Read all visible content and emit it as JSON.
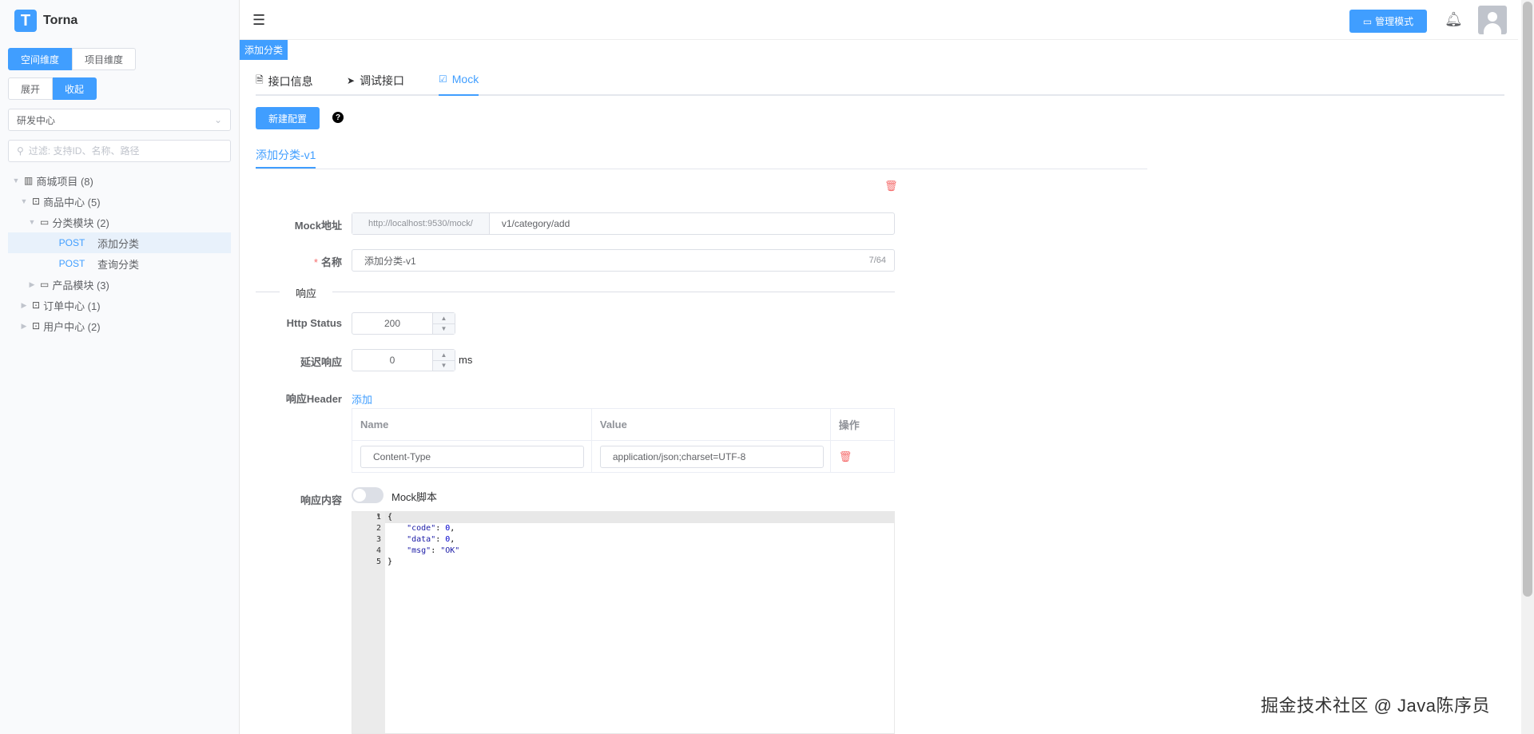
{
  "app": {
    "title": "Torna",
    "logo_letter": "T"
  },
  "sidebar": {
    "dimension_tabs": [
      {
        "label": "空间维度",
        "active": true
      },
      {
        "label": "项目维度",
        "active": false
      }
    ],
    "expand_tabs": [
      {
        "label": "展开",
        "active": false
      },
      {
        "label": "收起",
        "active": true
      }
    ],
    "space_select": "研发中心",
    "filter_placeholder": "过滤: 支持ID、名称、路径",
    "tree": [
      {
        "label": "商城项目 (8)",
        "icon": "project-icon",
        "level": 0,
        "expanded": true
      },
      {
        "label": "商品中心 (5)",
        "icon": "module-icon",
        "level": 1,
        "expanded": true
      },
      {
        "label": "分类模块 (2)",
        "icon": "folder-icon",
        "level": 2,
        "expanded": true
      },
      {
        "label": "添加分类",
        "method": "POST",
        "level": 3,
        "selected": true
      },
      {
        "label": "查询分类",
        "method": "POST",
        "level": 3,
        "selected": false
      },
      {
        "label": "产品模块 (3)",
        "icon": "folder-icon",
        "level": 2,
        "expanded": false
      },
      {
        "label": "订单中心 (1)",
        "icon": "module-icon",
        "level": 1,
        "expanded": false
      },
      {
        "label": "用户中心 (2)",
        "icon": "module-icon",
        "level": 1,
        "expanded": false
      }
    ]
  },
  "header": {
    "admin_button": "管理模式"
  },
  "breadcrumb_tag": "添加分类",
  "tabs": [
    {
      "label": "接口信息",
      "icon": "document-icon"
    },
    {
      "label": "调试接口",
      "icon": "send-icon"
    },
    {
      "label": "Mock",
      "icon": "mock-icon",
      "active": true
    }
  ],
  "mock": {
    "new_button": "新建配置",
    "help_icon": "?",
    "config_tab": "添加分类-v1",
    "form": {
      "address_label": "Mock地址",
      "address_prefix": "http://localhost:9530/mock/",
      "address_path": "v1/category/add",
      "name_label": "名称",
      "name_required": "*",
      "name_value": "添加分类-v1",
      "name_count": "7/64",
      "section_response": "响应",
      "http_status_label": "Http Status",
      "http_status_value": "200",
      "delay_label": "延迟响应",
      "delay_value": "0",
      "delay_unit": "ms",
      "header_label": "响应Header",
      "header_add": "添加",
      "header_columns": [
        "Name",
        "Value",
        "操作"
      ],
      "header_rows": [
        {
          "name": "Content-Type",
          "value": "application/json;charset=UTF-8"
        }
      ],
      "content_label": "响应内容",
      "mock_script_label": "Mock脚本",
      "mock_script_on": false
    },
    "code_lines": [
      "1",
      "2",
      "3",
      "4",
      "5"
    ]
  },
  "watermark": "掘金技术社区 @ Java陈序员",
  "colors": {
    "primary": "#409eff",
    "danger": "#f56c6c"
  }
}
